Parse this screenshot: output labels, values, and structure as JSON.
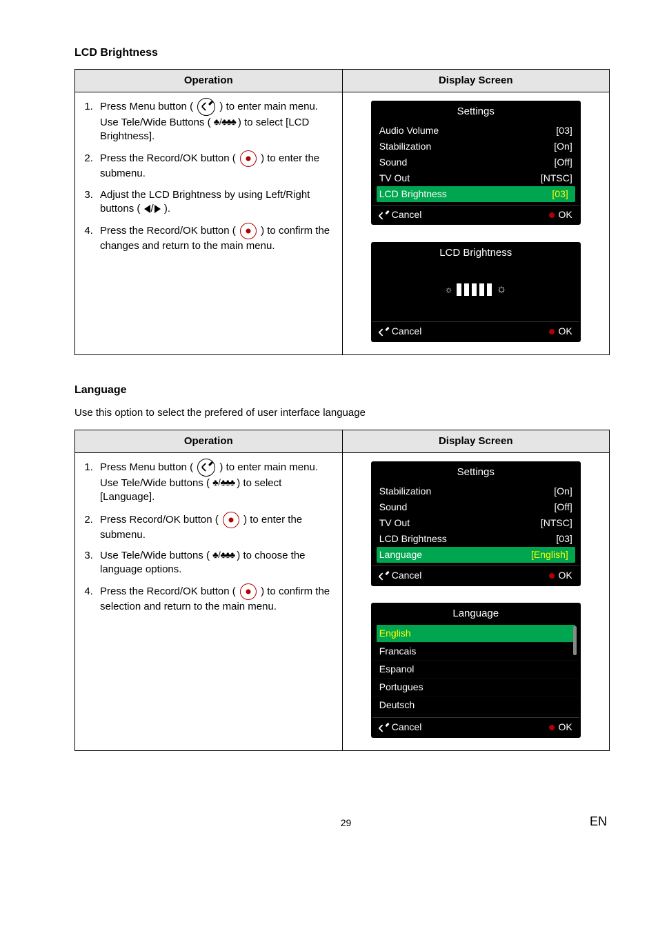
{
  "section1": {
    "title": "LCD Brightness",
    "table": {
      "opHeader": "Operation",
      "dsHeader": "Display Screen"
    },
    "steps": {
      "s1a": "Press Menu button ( ",
      "s1b": " ) to enter main menu. Use Tele/Wide Buttons ( ",
      "s1c": " ) to select [LCD Brightness].",
      "s2a": "Press the Record/OK button ( ",
      "s2b": " ) to enter the submenu.",
      "s3a": "Adjust the LCD Brightness by using Left/Right buttons ( ",
      "s3b": " ).",
      "s4a": "Press the Record/OK button ( ",
      "s4b": " ) to confirm the changes and return to the main menu."
    },
    "menu1": {
      "title": "Settings",
      "rows": [
        {
          "label": "Audio Volume",
          "value": "[03]"
        },
        {
          "label": "Stabilization",
          "value": "[On]"
        },
        {
          "label": "Sound",
          "value": "[Off]"
        },
        {
          "label": "TV Out",
          "value": "[NTSC]"
        },
        {
          "label": "LCD Brightness",
          "value": "[03]",
          "selected": true
        }
      ],
      "cancel": "Cancel",
      "ok": "OK"
    },
    "menu2": {
      "title": "LCD Brightness",
      "cancel": "Cancel",
      "ok": "OK"
    }
  },
  "section2": {
    "title": "Language",
    "intro": "Use this option to select the prefered of user interface language",
    "table": {
      "opHeader": "Operation",
      "dsHeader": "Display Screen"
    },
    "steps": {
      "s1a": "Press Menu button ( ",
      "s1b": " ) to enter main menu. Use Tele/Wide buttons ( ",
      "s1c": " ) to select [Language].",
      "s2a": "Press Record/OK button ( ",
      "s2b": " ) to enter the submenu.",
      "s3a": "Use Tele/Wide buttons ( ",
      "s3b": " ) to choose the language options.",
      "s4a": "Press the Record/OK button ( ",
      "s4b": " ) to confirm the selection and return to the main menu."
    },
    "menu1": {
      "title": "Settings",
      "rows": [
        {
          "label": "Stabilization",
          "value": "[On]"
        },
        {
          "label": "Sound",
          "value": "[Off]"
        },
        {
          "label": "TV Out",
          "value": "[NTSC]"
        },
        {
          "label": "LCD Brightness",
          "value": "[03]"
        },
        {
          "label": "Language",
          "value": "[English]",
          "selected": true
        }
      ],
      "cancel": "Cancel",
      "ok": "OK"
    },
    "menu2": {
      "title": "Language",
      "rows": [
        {
          "label": "English",
          "selected": true
        },
        {
          "label": "Francais"
        },
        {
          "label": "Espanol"
        },
        {
          "label": "Portugues"
        },
        {
          "label": "Deutsch"
        }
      ],
      "cancel": "Cancel",
      "ok": "OK"
    }
  },
  "footer": {
    "page": "29",
    "lang": "EN"
  }
}
